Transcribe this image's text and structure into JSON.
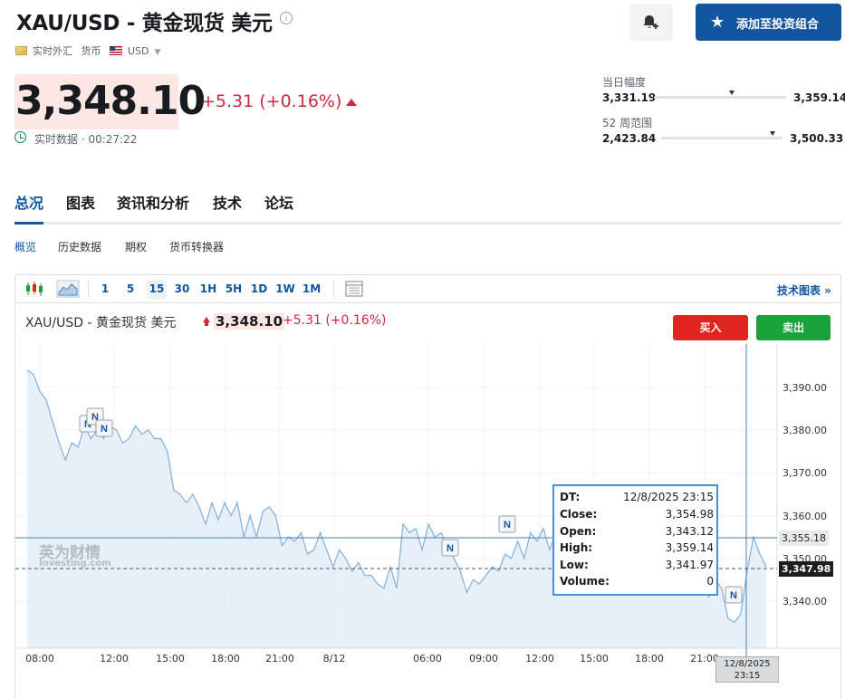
{
  "header": {
    "title": "XAU/USD - 黄金现货 美元",
    "add_portfolio_label": "添加至投资组合",
    "meta": {
      "type": "实时外汇",
      "category": "货币",
      "currency": "USD"
    }
  },
  "quote": {
    "price": "3,348.10",
    "change": "+5.31 (+0.16%)",
    "realtime_label": "实时数据 · 00:27:22",
    "day_range": {
      "label": "当日幅度",
      "low": "3,331.19",
      "high": "3,359.14",
      "position": 0.59
    },
    "week52_range": {
      "label": "52 周范围",
      "low": "2,423.84",
      "high": "3,500.33",
      "position": 0.92
    }
  },
  "tabs": [
    "总况",
    "图表",
    "资讯和分析",
    "技术",
    "论坛"
  ],
  "subtabs": [
    "概览",
    "历史数据",
    "期权",
    "货币转换器"
  ],
  "toolbar": {
    "timeframes": [
      "1",
      "5",
      "15",
      "30",
      "1H",
      "5H",
      "1D",
      "1W",
      "1M"
    ],
    "active_timeframe": "15",
    "tech_chart_label": "技术图表 »"
  },
  "chart_header": {
    "title": "XAU/USD - 黄金现货 美元",
    "price": "3,348.10",
    "change": "+5.31 (+0.16%)",
    "buy_label": "买入",
    "sell_label": "卖出"
  },
  "watermark": {
    "cn": "英为财情",
    "en": "Investing.com"
  },
  "tooltip": {
    "rows": [
      {
        "k": "DT:",
        "v": "12/8/2025 23:15"
      },
      {
        "k": "Close:",
        "v": "3,354.98"
      },
      {
        "k": "Open:",
        "v": "3,343.12"
      },
      {
        "k": "High:",
        "v": "3,359.14"
      },
      {
        "k": "Low:",
        "v": "3,341.97"
      },
      {
        "k": "Volume:",
        "v": "0"
      }
    ]
  },
  "axis": {
    "y_labels": [
      "3,390.00",
      "3,380.00",
      "3,370.00",
      "3,360.00",
      "3,350.00",
      "3,340.00"
    ],
    "x_labels": [
      "08:00",
      "12:00",
      "15:00",
      "18:00",
      "21:00",
      "8/12",
      "06:00",
      "09:00",
      "12:00",
      "15:00",
      "18:00",
      "21:00"
    ],
    "crosshair_price": "3,355.18",
    "last_price": "3,347.98",
    "crosshair_time_line1": "12/8/2025",
    "crosshair_time_line2": "23:15"
  },
  "news_markers": [
    "N",
    "N",
    "N",
    "N",
    "N",
    "N"
  ],
  "chart_data": {
    "type": "area",
    "ylim": [
      3332,
      3395
    ],
    "series": [
      {
        "values": [
          3394,
          3393,
          3389,
          3387,
          3382,
          3377,
          3373,
          3377,
          3376,
          3381,
          3378,
          3380,
          3378,
          3381,
          3380,
          3377,
          3378,
          3381,
          3379,
          3380,
          3378,
          3378,
          3375,
          3366,
          3365,
          3363,
          3365,
          3362,
          3358,
          3363,
          3359,
          3363,
          3360,
          3363,
          3355,
          3360,
          3355,
          3361,
          3362,
          3360,
          3353,
          3355,
          3354,
          3356,
          3351,
          3352,
          3356,
          3352,
          3348,
          3352,
          3350,
          3347,
          3349,
          3346,
          3346,
          3344,
          3343,
          3348,
          3343,
          3358,
          3356,
          3357,
          3352,
          3358,
          3355,
          3356,
          3352,
          3350,
          3347,
          3342,
          3345,
          3344,
          3346,
          3348,
          3347,
          3351,
          3350,
          3354,
          3350,
          3356,
          3354,
          3357,
          3352,
          3356,
          3358,
          3357,
          3355,
          3350,
          3351,
          3349,
          3352,
          3356,
          3354,
          3353,
          3357,
          3354,
          3356,
          3350,
          3351,
          3352,
          3350,
          3345,
          3347,
          3346,
          3349,
          3344,
          3345,
          3341,
          3345,
          3343,
          3336,
          3335,
          3337,
          3347,
          3355,
          3351,
          3348
        ]
      }
    ]
  }
}
